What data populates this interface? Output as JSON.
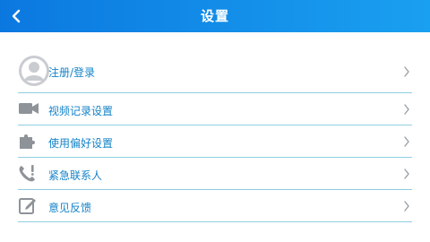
{
  "header": {
    "title": "设置",
    "back_icon": "chevron-left-icon",
    "gradient_start": "#0b78e0",
    "gradient_end": "#1aa0f0"
  },
  "menu": {
    "accent_color": "#1583c8",
    "divider_color": "#8ecfe0",
    "items": [
      {
        "label": "注册/登录",
        "icon": "avatar-icon"
      },
      {
        "label": "视频记录设置",
        "icon": "video-camera-icon"
      },
      {
        "label": "使用偏好设置",
        "icon": "puzzle-icon"
      },
      {
        "label": "紧急联系人",
        "icon": "phone-alert-icon"
      },
      {
        "label": "意见反馈",
        "icon": "edit-icon"
      }
    ]
  }
}
